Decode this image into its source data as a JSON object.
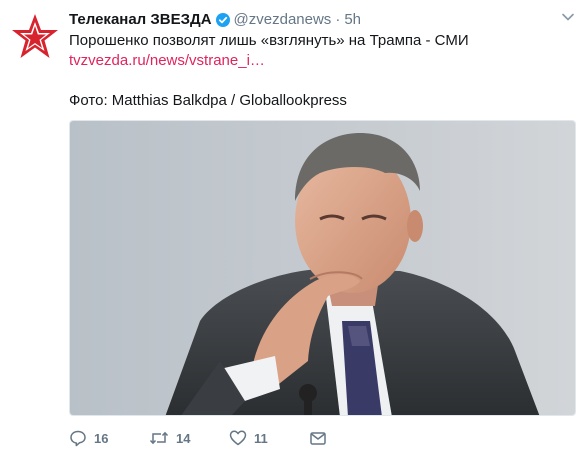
{
  "tweet": {
    "account_name": "Телеканал ЗВЕЗДА",
    "handle": "@zvezdanews",
    "separator": "·",
    "time": "5h",
    "text_line": "Порошенко позволят лишь «взглянуть» на Трампа - СМИ",
    "link_text": "tvzvezda.ru/news/vstrane_i…",
    "photo_credit": "Фото: Matthias Balkdpa / Globallookpress"
  },
  "actions": {
    "reply_count": "16",
    "retweet_count": "14",
    "like_count": "11"
  },
  "colors": {
    "name_text": "#14171a",
    "meta_text": "#657786",
    "link": "#e0245e",
    "verified": "#1da1f2",
    "brand_red": "#d6232e"
  },
  "icons": [
    "zvezda-star-logo",
    "verified-badge-icon",
    "chevron-down-icon",
    "reply-icon",
    "retweet-icon",
    "like-icon",
    "direct-message-icon"
  ]
}
